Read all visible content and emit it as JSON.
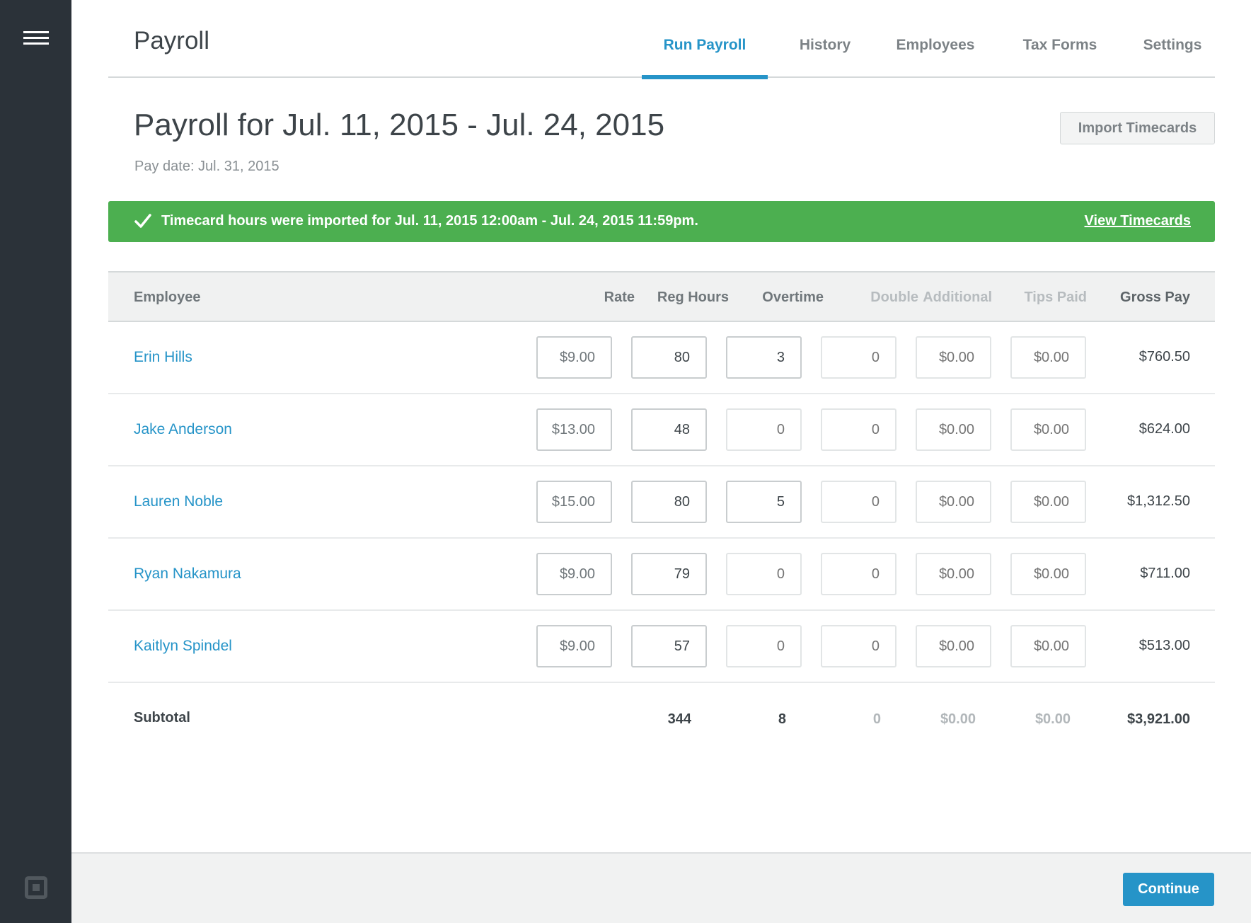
{
  "sidebar": {
    "menu_icon": "hamburger-menu-icon",
    "logo_icon": "square-logo-icon"
  },
  "header": {
    "title": "Payroll",
    "tabs": [
      {
        "label": "Run Payroll",
        "active": true
      },
      {
        "label": "History",
        "active": false
      },
      {
        "label": "Employees",
        "active": false
      },
      {
        "label": "Tax Forms",
        "active": false
      },
      {
        "label": "Settings",
        "active": false
      }
    ]
  },
  "page": {
    "title": "Payroll for Jul. 11, 2015 - Jul. 24, 2015",
    "pay_date": "Pay date: Jul. 31, 2015",
    "import_button": "Import Timecards"
  },
  "banner": {
    "icon": "checkmark-icon",
    "message": "Timecard hours were imported for Jul. 11, 2015 12:00am - Jul. 24, 2015 11:59pm.",
    "link": "View Timecards",
    "color": "#4caf50"
  },
  "table": {
    "columns": [
      "Employee",
      "Rate",
      "Reg Hours",
      "Overtime",
      "Double",
      "Additional",
      "Tips Paid",
      "Gross Pay"
    ],
    "rows": [
      {
        "employee": "Erin Hills",
        "rate": "$9.00",
        "reg_hours": "80",
        "overtime": "3",
        "double": "0",
        "additional": "$0.00",
        "tips_paid": "$0.00",
        "gross_pay": "$760.50"
      },
      {
        "employee": "Jake Anderson",
        "rate": "$13.00",
        "reg_hours": "48",
        "overtime": "0",
        "double": "0",
        "additional": "$0.00",
        "tips_paid": "$0.00",
        "gross_pay": "$624.00"
      },
      {
        "employee": "Lauren Noble",
        "rate": "$15.00",
        "reg_hours": "80",
        "overtime": "5",
        "double": "0",
        "additional": "$0.00",
        "tips_paid": "$0.00",
        "gross_pay": "$1,312.50"
      },
      {
        "employee": "Ryan Nakamura",
        "rate": "$9.00",
        "reg_hours": "79",
        "overtime": "0",
        "double": "0",
        "additional": "$0.00",
        "tips_paid": "$0.00",
        "gross_pay": "$711.00"
      },
      {
        "employee": "Kaitlyn Spindel",
        "rate": "$9.00",
        "reg_hours": "57",
        "overtime": "0",
        "double": "0",
        "additional": "$0.00",
        "tips_paid": "$0.00",
        "gross_pay": "$513.00"
      }
    ],
    "subtotal": {
      "label": "Subtotal",
      "reg_hours": "344",
      "overtime": "8",
      "double": "0",
      "additional": "$0.00",
      "tips_paid": "$0.00",
      "gross_pay": "$3,921.00"
    }
  },
  "footer": {
    "continue_button": "Continue"
  },
  "colors": {
    "accent": "#2694c8",
    "sidebar": "#2b3239",
    "success": "#4caf50"
  }
}
